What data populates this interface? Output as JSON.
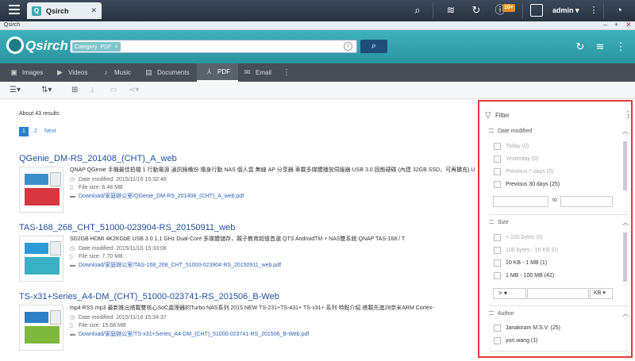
{
  "os": {
    "tab_label": "Qsirch",
    "tab_icon": "Q",
    "tab_close": "✕",
    "notif_count": "10+",
    "user": "admin"
  },
  "window": {
    "title": "Qsirch",
    "min": "–",
    "max": "+",
    "close": "✕"
  },
  "header": {
    "logo": "Qsirch",
    "chip_label": "Category",
    "chip_value": "PDF",
    "chip_close": "×",
    "search_value": "",
    "clear_symbol": "×"
  },
  "tabs": [
    {
      "label": "Images"
    },
    {
      "label": "Videos"
    },
    {
      "label": "Music"
    },
    {
      "label": "Documents"
    },
    {
      "label": "PDF"
    },
    {
      "label": "Email"
    }
  ],
  "results": {
    "count": "About 43 results",
    "pages": [
      "1",
      "2"
    ],
    "next": "Next",
    "items": [
      {
        "title": "QGenie_DM-RS_201408_(CHT)_A_web",
        "desc": "QNAP QGenie 手機最佳拍檔 1 行動電源 通訊錄備份 隨身行動 NAS 個人雲 無線 AP 分享器 車載多媒體播放伺服器 USB 3.0 固態硬碟 (內建 32GB SSD，可再擴充) U",
        "date": "Date modified: 2015/11/16 15:32:46",
        "size": "File size: 6.48 MB",
        "path": "Download/家庭辦公室/QGenie_DM-RS_201408_(CHT)_A_web.pdf"
      },
      {
        "title": "TAS-168_268_CHT_51000-023904-RS_20150911_web",
        "desc": "SD2GB HDMI 4K2KGbE USB 3.0 1.1 GHz Dual-Core 多媒體儲存，親子教育超值首選 QTS AndroidTM + NAS雙系統 QNAP TAS-168 / T",
        "date": "Date modified: 2015/11/16 15:33:08",
        "size": "File size: 7.70 MB",
        "path": "Download/家庭辦公室/TAS-168_268_CHT_51000-023904-RS_20150911_web.pdf"
      },
      {
        "title": "TS-x31+Series_A4-DM_(CHT)_51000-023741-RS_201506_B-Web",
        "desc": "mp4 RSS mp3 最新推出搭載雙核心SoC處理器的Turbo NAS系列 2015 NEW TS-231+TS-431+ TS-x31+ 系列 特點介紹 搭載先進28奈米ARM Cortex-",
        "date": "Date modified: 2015/11/16 15:34:37",
        "size": "File size: 15.68 MB",
        "path": "Download/家庭辦公室/TS-x31+Series_A4-DM_(CHT)_51000-023741-RS_201506_B-Web.pdf"
      }
    ]
  },
  "filter": {
    "title": "Filter",
    "date": {
      "heading": "Date modified",
      "options": [
        "Today (0)",
        "Yesterday (0)",
        "Previous 7 days (0)",
        "Previous 30 days (25)"
      ],
      "to": "to"
    },
    "size": {
      "heading": "Size",
      "options": [
        "< 100 bytes (0)",
        "100 bytes - 10 KB (0)",
        "10 KB - 1 MB (1)",
        "1 MB - 100 MB (42)"
      ],
      "operator": ">",
      "unit": "KB"
    },
    "author": {
      "heading": "Author",
      "options": [
        "Janakiram M.S.V. (25)",
        "yuri.wang (1)"
      ]
    }
  },
  "colors": {
    "accent": "#3db2bd",
    "highlight": "#e53935",
    "link": "#1f4e9e"
  }
}
